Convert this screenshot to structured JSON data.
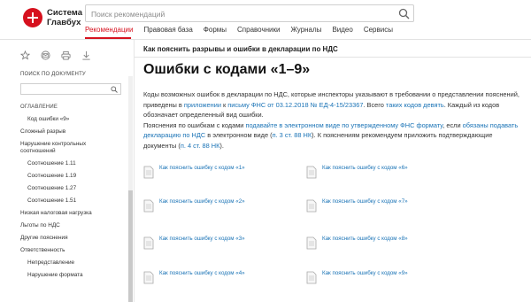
{
  "brand": {
    "line1": "Система",
    "line2": "Главбух"
  },
  "search": {
    "placeholder": "Поиск рекомендаций"
  },
  "nav": {
    "tabs": [
      {
        "label": "Рекомендации"
      },
      {
        "label": "Правовая база"
      },
      {
        "label": "Формы"
      },
      {
        "label": "Справочники"
      },
      {
        "label": "Журналы"
      },
      {
        "label": "Видео"
      },
      {
        "label": "Сервисы"
      }
    ]
  },
  "sidebar": {
    "search_title": "ПОИСК ПО ДОКУМЕНТУ",
    "toc_title": "ОГЛАВЛЕНИЕ",
    "items": [
      {
        "label": "Код ошибки «9»"
      },
      {
        "label": "Сложный разрыв"
      },
      {
        "label": "Нарушение контрольных соотношений"
      },
      {
        "label": "Соотношение 1.11"
      },
      {
        "label": "Соотношение 1.19"
      },
      {
        "label": "Соотношение 1.27"
      },
      {
        "label": "Соотношение 1.51"
      },
      {
        "label": "Низкая налоговая нагрузка"
      },
      {
        "label": "Льготы по НДС"
      },
      {
        "label": "Другие пояснения"
      },
      {
        "label": "Ответственность"
      },
      {
        "label": "Непредставление"
      },
      {
        "label": "Нарушение формата"
      }
    ]
  },
  "main": {
    "breadcrumb": "Как пояснить разрывы и ошибки в декларации по НДС",
    "title": "Ошибки с кодами «1–9»",
    "p1": {
      "t1": "Коды возможных ошибок в декларации по НДС, которые инспекторы указывают в требовании о представлении пояснений, приведены в ",
      "a1": "приложении",
      "t2": " к ",
      "a2": "письму ФНС от 03.12.2018 № ЕД-4-15/23367",
      "t3": ". Всего ",
      "a3": "таких кодов девять",
      "t4": ". Каждый из кодов обозначает определенный вид ошибки."
    },
    "p2": {
      "t1": "Пояснения по ошибкам с кодами ",
      "a1": "подавайте в электронном виде по утвержденному ФНС формату",
      "t2": ", если ",
      "a2": "обязаны подавать декларацию по НДС",
      "t3": " в электронном виде (",
      "a3": "п. 3 ст. 88 НК",
      "t4": "). К пояснениям рекомендуем приложить подтверждающие документы (",
      "a4": "п. 4 ст. 88 НК",
      "t5": ")."
    },
    "links": [
      {
        "label": "Как пояснить ошибку с кодом «1»"
      },
      {
        "label": "Как пояснить ошибку с кодом «6»"
      },
      {
        "label": "Как пояснить ошибку с кодом «2»"
      },
      {
        "label": "Как пояснить ошибку с кодом «7»"
      },
      {
        "label": "Как пояснить ошибку с кодом «3»"
      },
      {
        "label": "Как пояснить ошибку с кодом «8»"
      },
      {
        "label": "Как пояснить ошибку с кодом «4»"
      },
      {
        "label": "Как пояснить ошибку с кодом «9»"
      }
    ]
  },
  "colors": {
    "accent": "#d6111e",
    "link": "#1a73b6"
  }
}
